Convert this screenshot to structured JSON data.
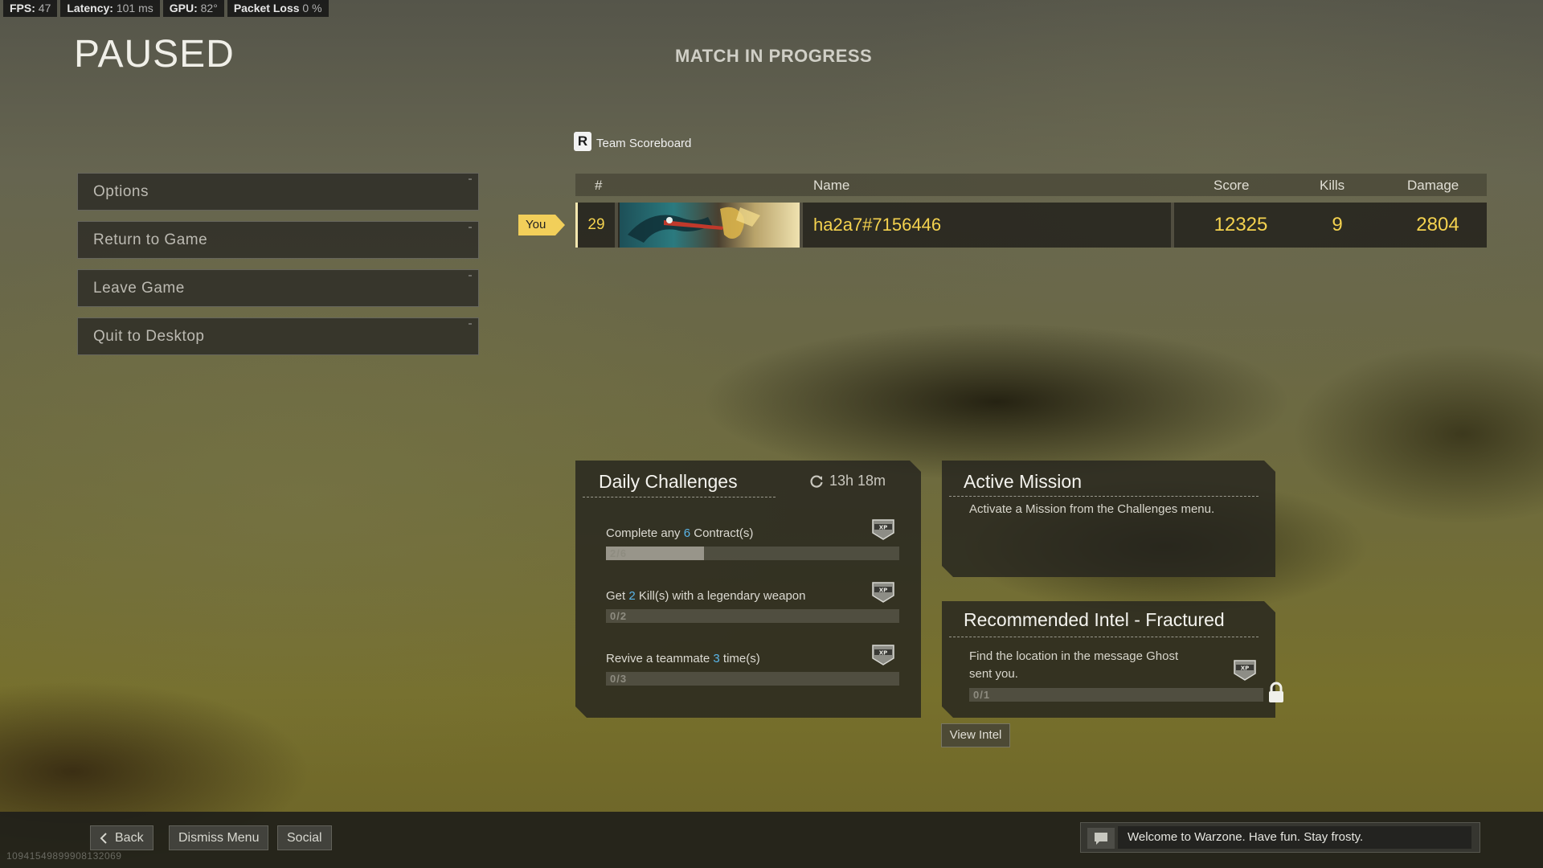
{
  "perf": [
    {
      "label": "FPS:",
      "value": "47"
    },
    {
      "label": "Latency:",
      "value": "101 ms"
    },
    {
      "label": "GPU:",
      "value": "82°"
    },
    {
      "label": "Packet Loss",
      "value": "0 %"
    }
  ],
  "title": "PAUSED",
  "match_status": "MATCH IN PROGRESS",
  "menu": {
    "items": [
      "Options",
      "Return to Game",
      "Leave Game",
      "Quit to Desktop"
    ]
  },
  "scoreboard": {
    "key": "R",
    "label": "Team Scoreboard",
    "headers": {
      "rank": "#",
      "name": "Name",
      "score": "Score",
      "kills": "Kills",
      "damage": "Damage"
    },
    "you_tag": "You",
    "row": {
      "rank": "29",
      "name": "ha2a7#7156446",
      "score": "12325",
      "kills": "9",
      "damage": "2804"
    }
  },
  "daily": {
    "title": "Daily Challenges",
    "timer": "13h 18m",
    "challenges": [
      {
        "pre": "Complete any ",
        "num": "6",
        "post": " Contract(s)",
        "progress_label": "2/6",
        "progress": 0.3333
      },
      {
        "pre": "Get ",
        "num": "2",
        "post": " Kill(s) with a legendary weapon",
        "progress_label": "0/2",
        "progress": 0
      },
      {
        "pre": "Revive a teammate ",
        "num": "3",
        "post": " time(s)",
        "progress_label": "0/3",
        "progress": 0
      }
    ]
  },
  "active_mission": {
    "title": "Active Mission",
    "text": "Activate a Mission from the Challenges menu."
  },
  "intel": {
    "title": "Recommended Intel - Fractured",
    "text_line1": "Find the location in the message Ghost",
    "text_line2": "sent you.",
    "progress_label": "0/1",
    "progress": 0,
    "button": "View Intel"
  },
  "bottom": {
    "back": "Back",
    "dismiss": "Dismiss Menu",
    "social": "Social",
    "id": "10941549899908132069",
    "chat_message": "Welcome to Warzone. Have fun. Stay frosty."
  },
  "colors": {
    "accent": "#f4d24f",
    "highlight": "#5ab5e8"
  }
}
